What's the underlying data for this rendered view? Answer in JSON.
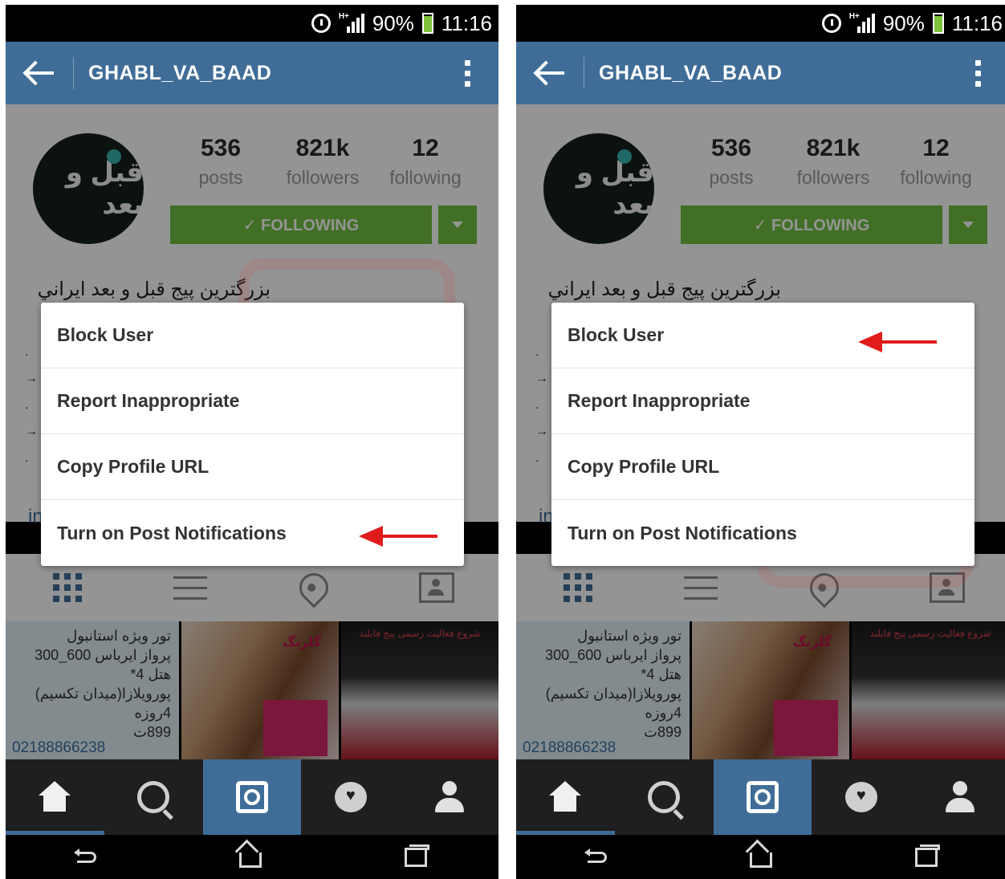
{
  "status_bar": {
    "network": "H+",
    "battery": "90%",
    "time": "11:16"
  },
  "app_bar": {
    "username": "GHABL_VA_BAAD"
  },
  "profile": {
    "avatar_text": "قبل و بعد",
    "stats": [
      {
        "value": "536",
        "label": "posts"
      },
      {
        "value": "821k",
        "label": "followers"
      },
      {
        "value": "12",
        "label": "following"
      }
    ],
    "follow_button": "✓ FOLLOWING",
    "bio": "بزرگترين پيج قبل و بعد ايراني",
    "bio_bullets": [
      ".",
      "→",
      ".",
      "→",
      "."
    ],
    "bio_link": "in"
  },
  "menu": {
    "items": [
      "Block User",
      "Report Inappropriate",
      "Copy Profile URL",
      "Turn on Post Notifications"
    ]
  },
  "tiles": {
    "tile1_lines": [
      "تور ويژه استانبول",
      "پرواز ايرباس 600_300",
      "هتل 4*",
      "پورويلازا(ميدان تكسيم)",
      "4روزه",
      "899ت"
    ],
    "tile1_phone": "02188866238",
    "tile2_label": "گلرنگ",
    "tile3_label": "شروع فعالیت رسمی پیج فایلند"
  },
  "annotations": {
    "left_arrow_target": "Turn on Post Notifications",
    "right_arrow_target": "Block User"
  },
  "colors": {
    "accent": "#3f6d98",
    "follow_green": "#6fbf40",
    "arrow_red": "#e01c1c"
  },
  "icons": {
    "app_bar": [
      "back-arrow-icon",
      "more-vert-icon"
    ],
    "tabs": [
      "grid-icon",
      "list-icon",
      "location-pin-icon",
      "tagged-photos-icon"
    ],
    "bottom_nav": [
      "home-icon",
      "search-icon",
      "camera-icon",
      "activity-icon",
      "profile-icon"
    ],
    "system_nav": [
      "system-back-icon",
      "system-home-icon",
      "recent-apps-icon"
    ]
  }
}
